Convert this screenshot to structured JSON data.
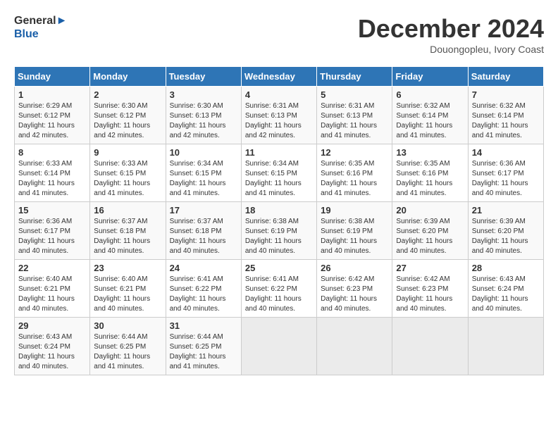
{
  "header": {
    "logo_line1": "General",
    "logo_line2": "Blue",
    "month": "December 2024",
    "location": "Douongopleu, Ivory Coast"
  },
  "weekdays": [
    "Sunday",
    "Monday",
    "Tuesday",
    "Wednesday",
    "Thursday",
    "Friday",
    "Saturday"
  ],
  "weeks": [
    [
      {
        "day": "1",
        "info": "Sunrise: 6:29 AM\nSunset: 6:12 PM\nDaylight: 11 hours\nand 42 minutes."
      },
      {
        "day": "2",
        "info": "Sunrise: 6:30 AM\nSunset: 6:12 PM\nDaylight: 11 hours\nand 42 minutes."
      },
      {
        "day": "3",
        "info": "Sunrise: 6:30 AM\nSunset: 6:13 PM\nDaylight: 11 hours\nand 42 minutes."
      },
      {
        "day": "4",
        "info": "Sunrise: 6:31 AM\nSunset: 6:13 PM\nDaylight: 11 hours\nand 42 minutes."
      },
      {
        "day": "5",
        "info": "Sunrise: 6:31 AM\nSunset: 6:13 PM\nDaylight: 11 hours\nand 41 minutes."
      },
      {
        "day": "6",
        "info": "Sunrise: 6:32 AM\nSunset: 6:14 PM\nDaylight: 11 hours\nand 41 minutes."
      },
      {
        "day": "7",
        "info": "Sunrise: 6:32 AM\nSunset: 6:14 PM\nDaylight: 11 hours\nand 41 minutes."
      }
    ],
    [
      {
        "day": "8",
        "info": "Sunrise: 6:33 AM\nSunset: 6:14 PM\nDaylight: 11 hours\nand 41 minutes."
      },
      {
        "day": "9",
        "info": "Sunrise: 6:33 AM\nSunset: 6:15 PM\nDaylight: 11 hours\nand 41 minutes."
      },
      {
        "day": "10",
        "info": "Sunrise: 6:34 AM\nSunset: 6:15 PM\nDaylight: 11 hours\nand 41 minutes."
      },
      {
        "day": "11",
        "info": "Sunrise: 6:34 AM\nSunset: 6:15 PM\nDaylight: 11 hours\nand 41 minutes."
      },
      {
        "day": "12",
        "info": "Sunrise: 6:35 AM\nSunset: 6:16 PM\nDaylight: 11 hours\nand 41 minutes."
      },
      {
        "day": "13",
        "info": "Sunrise: 6:35 AM\nSunset: 6:16 PM\nDaylight: 11 hours\nand 41 minutes."
      },
      {
        "day": "14",
        "info": "Sunrise: 6:36 AM\nSunset: 6:17 PM\nDaylight: 11 hours\nand 40 minutes."
      }
    ],
    [
      {
        "day": "15",
        "info": "Sunrise: 6:36 AM\nSunset: 6:17 PM\nDaylight: 11 hours\nand 40 minutes."
      },
      {
        "day": "16",
        "info": "Sunrise: 6:37 AM\nSunset: 6:18 PM\nDaylight: 11 hours\nand 40 minutes."
      },
      {
        "day": "17",
        "info": "Sunrise: 6:37 AM\nSunset: 6:18 PM\nDaylight: 11 hours\nand 40 minutes."
      },
      {
        "day": "18",
        "info": "Sunrise: 6:38 AM\nSunset: 6:19 PM\nDaylight: 11 hours\nand 40 minutes."
      },
      {
        "day": "19",
        "info": "Sunrise: 6:38 AM\nSunset: 6:19 PM\nDaylight: 11 hours\nand 40 minutes."
      },
      {
        "day": "20",
        "info": "Sunrise: 6:39 AM\nSunset: 6:20 PM\nDaylight: 11 hours\nand 40 minutes."
      },
      {
        "day": "21",
        "info": "Sunrise: 6:39 AM\nSunset: 6:20 PM\nDaylight: 11 hours\nand 40 minutes."
      }
    ],
    [
      {
        "day": "22",
        "info": "Sunrise: 6:40 AM\nSunset: 6:21 PM\nDaylight: 11 hours\nand 40 minutes."
      },
      {
        "day": "23",
        "info": "Sunrise: 6:40 AM\nSunset: 6:21 PM\nDaylight: 11 hours\nand 40 minutes."
      },
      {
        "day": "24",
        "info": "Sunrise: 6:41 AM\nSunset: 6:22 PM\nDaylight: 11 hours\nand 40 minutes."
      },
      {
        "day": "25",
        "info": "Sunrise: 6:41 AM\nSunset: 6:22 PM\nDaylight: 11 hours\nand 40 minutes."
      },
      {
        "day": "26",
        "info": "Sunrise: 6:42 AM\nSunset: 6:23 PM\nDaylight: 11 hours\nand 40 minutes."
      },
      {
        "day": "27",
        "info": "Sunrise: 6:42 AM\nSunset: 6:23 PM\nDaylight: 11 hours\nand 40 minutes."
      },
      {
        "day": "28",
        "info": "Sunrise: 6:43 AM\nSunset: 6:24 PM\nDaylight: 11 hours\nand 40 minutes."
      }
    ],
    [
      {
        "day": "29",
        "info": "Sunrise: 6:43 AM\nSunset: 6:24 PM\nDaylight: 11 hours\nand 40 minutes."
      },
      {
        "day": "30",
        "info": "Sunrise: 6:44 AM\nSunset: 6:25 PM\nDaylight: 11 hours\nand 41 minutes."
      },
      {
        "day": "31",
        "info": "Sunrise: 6:44 AM\nSunset: 6:25 PM\nDaylight: 11 hours\nand 41 minutes."
      },
      {
        "day": "",
        "info": ""
      },
      {
        "day": "",
        "info": ""
      },
      {
        "day": "",
        "info": ""
      },
      {
        "day": "",
        "info": ""
      }
    ]
  ]
}
